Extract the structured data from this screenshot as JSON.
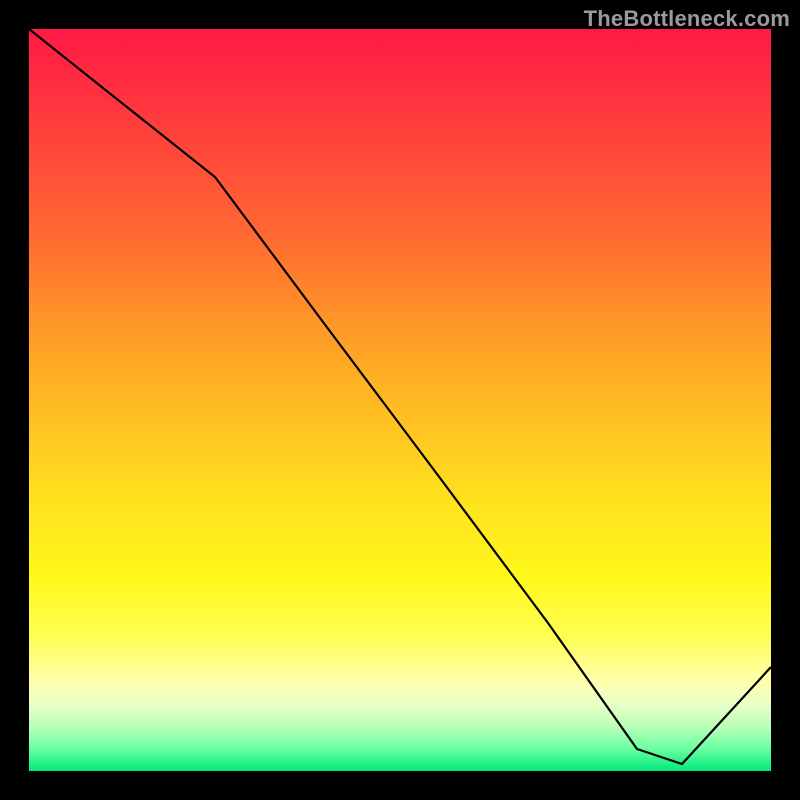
{
  "watermark": "TheBottleneck.com",
  "marker_label": "",
  "chart_data": {
    "type": "line",
    "title": "",
    "xlabel": "",
    "ylabel": "",
    "xlim": [
      0,
      100
    ],
    "ylim": [
      0,
      100
    ],
    "series": [
      {
        "name": "bottleneck-curve",
        "x": [
          0,
          10,
          25,
          40,
          55,
          70,
          82,
          88,
          100
        ],
        "values": [
          100,
          92,
          80,
          60,
          40,
          20,
          3,
          1,
          14
        ]
      }
    ],
    "background_gradient": {
      "orientation": "vertical",
      "stops": [
        {
          "pos": 0.0,
          "color": "#ff1945"
        },
        {
          "pos": 0.12,
          "color": "#ff3a3d"
        },
        {
          "pos": 0.28,
          "color": "#ff6a32"
        },
        {
          "pos": 0.4,
          "color": "#ff9828"
        },
        {
          "pos": 0.52,
          "color": "#ffbf22"
        },
        {
          "pos": 0.64,
          "color": "#ffe31e"
        },
        {
          "pos": 0.74,
          "color": "#fff81a"
        },
        {
          "pos": 0.82,
          "color": "#fffe55"
        },
        {
          "pos": 0.88,
          "color": "#ffffae"
        },
        {
          "pos": 0.91,
          "color": "#e9ffc8"
        },
        {
          "pos": 0.94,
          "color": "#b9ffb8"
        },
        {
          "pos": 0.97,
          "color": "#6bffa2"
        },
        {
          "pos": 1.0,
          "color": "#00e97a"
        }
      ]
    },
    "marker": {
      "x": 85,
      "y": 1,
      "label": ""
    }
  }
}
